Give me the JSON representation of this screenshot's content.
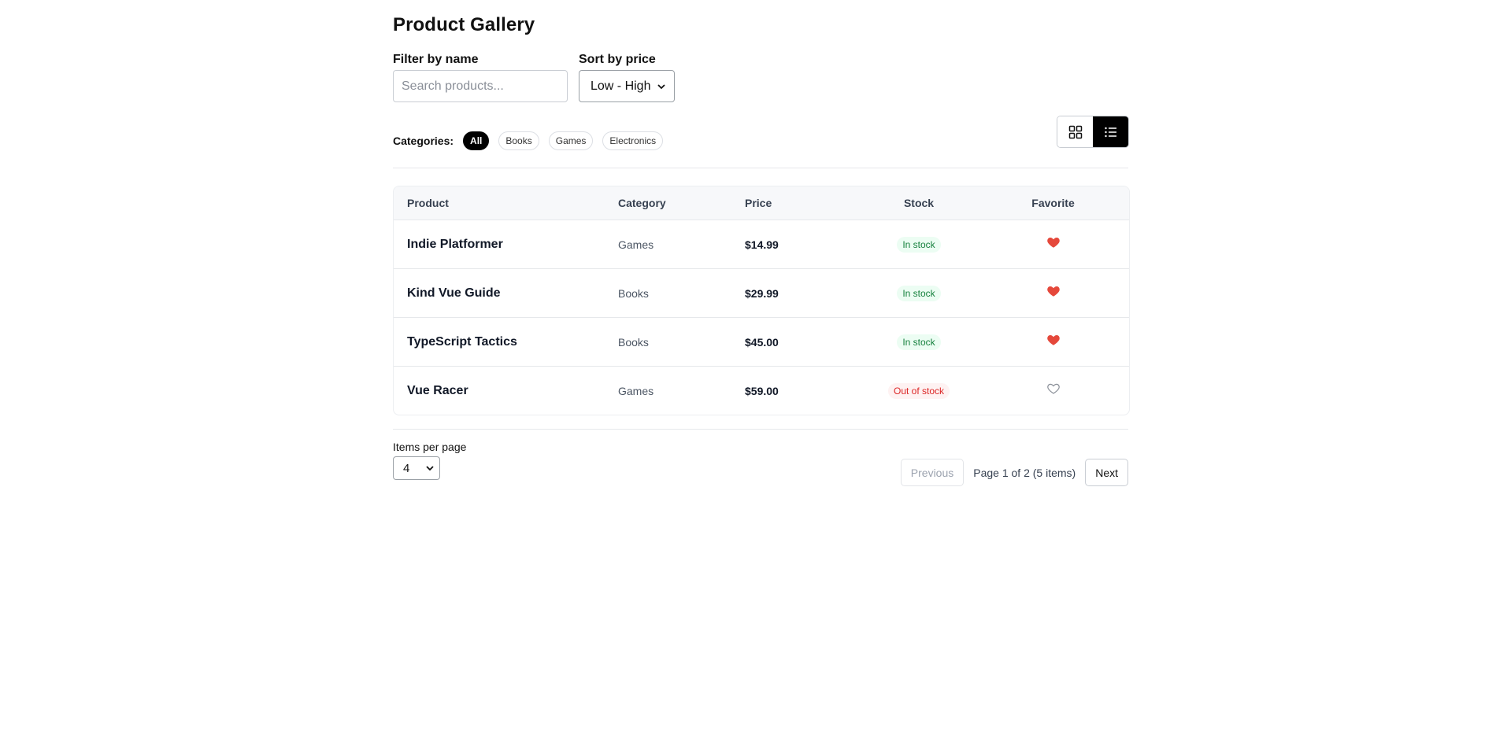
{
  "page": {
    "title": "Product Gallery"
  },
  "filter": {
    "label": "Filter by name",
    "placeholder": "Search products...",
    "value": ""
  },
  "sort": {
    "label": "Sort by price",
    "selected": "Low - High"
  },
  "categories": {
    "label": "Categories:",
    "items": [
      "All",
      "Books",
      "Games",
      "Electronics"
    ],
    "active": "All"
  },
  "view": {
    "grid_icon": "grid-icon",
    "list_icon": "list-icon",
    "active": "list"
  },
  "table": {
    "headers": [
      "Product",
      "Category",
      "Price",
      "Stock",
      "Favorite"
    ],
    "rows": [
      {
        "name": "Indie Platformer",
        "category": "Games",
        "price": "$14.99",
        "stock": "In stock",
        "in_stock": true,
        "favorite": true
      },
      {
        "name": "Kind Vue Guide",
        "category": "Books",
        "price": "$29.99",
        "stock": "In stock",
        "in_stock": true,
        "favorite": true
      },
      {
        "name": "TypeScript Tactics",
        "category": "Books",
        "price": "$45.00",
        "stock": "In stock",
        "in_stock": true,
        "favorite": true
      },
      {
        "name": "Vue Racer",
        "category": "Games",
        "price": "$59.00",
        "stock": "Out of stock",
        "in_stock": false,
        "favorite": false
      }
    ]
  },
  "pagination": {
    "items_per_page_label": "Items per page",
    "items_per_page": "4",
    "previous_label": "Previous",
    "next_label": "Next",
    "info": "Page 1 of 2 (5 items)"
  },
  "colors": {
    "accent": "#000000",
    "in_stock": "#15803d",
    "out_of_stock": "#dc2626",
    "heart": "#e5483b"
  }
}
